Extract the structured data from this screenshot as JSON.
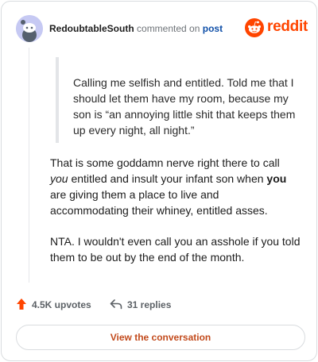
{
  "header": {
    "username": "RedoubtableSouth",
    "action_text": "commented on",
    "post_link": "post",
    "brand": "reddit",
    "avatar_icon": "snoo-avatar-icon",
    "brand_icon": "reddit-logo-icon"
  },
  "quote": {
    "text": "Calling me selfish and entitled. Told me that I should let them have my room, because my son is “an annoying little shit that keeps them up every night, all night.”"
  },
  "comment": {
    "p1_a": "That is some goddamn nerve right there to call ",
    "p1_em": "you",
    "p1_b": " entitled and insult your infant son when ",
    "p1_strong": "you",
    "p1_c": " are giving them a place to live and accommodating their whiney, entitled asses.",
    "p2": "NTA. I wouldn't even call you an asshole if you told them to be out by the end of the month."
  },
  "footer": {
    "upvotes": "4.5K upvotes",
    "replies": "31 replies",
    "upvote_icon": "upvote-arrow-icon",
    "reply_icon": "reply-arrow-icon"
  },
  "cta": {
    "label": "View the conversation"
  },
  "colors": {
    "brand": "#ff4500",
    "link": "#0f4fa8",
    "cta_text": "#c24a1c",
    "avatar_bg": "#c6c9f3"
  }
}
